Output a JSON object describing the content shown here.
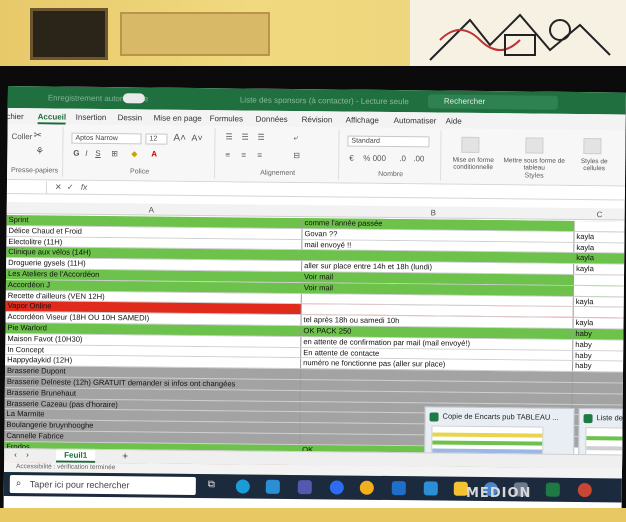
{
  "titlebar": {
    "autosave": "Enregistrement automatique",
    "doc_title": "Liste des sponsors (à contacter) - Lecture seule",
    "search_placeholder": "Rechercher"
  },
  "menu": [
    "Fichier",
    "Accueil",
    "Insertion",
    "Dessin",
    "Mise en page",
    "Formules",
    "Données",
    "Révision",
    "Affichage",
    "Automatiser",
    "Aide"
  ],
  "ribbon": {
    "font_name": "Aptos Narrow",
    "font_size": "12",
    "number_format": "Standard",
    "groups": {
      "clipboard": "Presse-papiers",
      "font": "Police",
      "alignment": "Alignement",
      "number": "Nombre",
      "styles": "Styles"
    },
    "styles_buttons": [
      "Mise en forme conditionnelle",
      "Mettre sous forme de tableau",
      "Styles de cellules"
    ],
    "paste": "Coller",
    "number_symbols": "% 000"
  },
  "formula_bar": {
    "fx": "fx"
  },
  "columns": [
    "A",
    "B",
    "C"
  ],
  "rows": [
    {
      "a": "Sprint",
      "b": "comme l'année passée",
      "c": "",
      "bg": "green"
    },
    {
      "a": "Délice Chaud et Froid",
      "b": "Govan ??",
      "c": "kayla",
      "bg": "white"
    },
    {
      "a": "Electolitre (11H)",
      "b": "mail envoyé !!",
      "c": "kayla",
      "bg": "white"
    },
    {
      "a": "Clinique aux vélos (14H)",
      "b": "",
      "c": "kayla",
      "bg": "green"
    },
    {
      "a": "Droguerie gysels (11H)",
      "b": "aller sur place entre 14h et 18h (lundi)",
      "c": "kayla",
      "bg": "white"
    },
    {
      "a": "Les Ateliers de l'Accordéon",
      "b": "Voir mail",
      "c": "",
      "bg": "green"
    },
    {
      "a": "Accordéon J",
      "b": "Voir mail",
      "c": "",
      "bg": "green"
    },
    {
      "a": "Recette d'ailleurs (VEN 12H)",
      "b": "",
      "c": "kayla",
      "bg": "white"
    },
    {
      "a": "Vapor Online",
      "b": "",
      "c": "",
      "bg": "red"
    },
    {
      "a": "Accordéon Viseur (18H OU 10H SAMEDI)",
      "b": "tel après 18h ou samedi 10h",
      "c": "kayla",
      "bg": "white"
    },
    {
      "a": "Pie Warlord",
      "b": "OK PACK 250",
      "c": "haby",
      "bg": "green"
    },
    {
      "a": "Maison Favot (10H30)",
      "b": "en attente de confirmation par mail (mail envoyé!)",
      "c": "haby",
      "bg": "white"
    },
    {
      "a": "In Concept",
      "b": "En attente de contacte",
      "c": "haby",
      "bg": "white"
    },
    {
      "a": "Happydaykid (12H)",
      "b": "numéro ne fonctionne pas (aller sur place)",
      "c": "haby",
      "bg": "white"
    },
    {
      "a": "Brasserie Dupont",
      "b": "",
      "c": "",
      "bg": "gray"
    },
    {
      "a": "Brasserie Delneste (12h) GRATUIT demander si infos ont changées",
      "b": "",
      "c": "",
      "bg": "gray"
    },
    {
      "a": "Brasserie Brunehaut",
      "b": "",
      "c": "",
      "bg": "gray"
    },
    {
      "a": "Brasserie Cazeau (pas d'horaire)",
      "b": "",
      "c": "",
      "bg": "gray"
    },
    {
      "a": "La Marmite",
      "b": "",
      "c": "",
      "bg": "gray"
    },
    {
      "a": "Boulangerie bruynhooghe",
      "b": "",
      "c": "",
      "bg": "gray"
    },
    {
      "a": "Cannelle Fabrice",
      "b": "",
      "c": "",
      "bg": "gray"
    },
    {
      "a": "Frodos",
      "b": "OK",
      "c": "",
      "bg": "green"
    },
    {
      "a": "Arc-en-ciel",
      "b": "",
      "c": "",
      "bg": "red"
    },
    {
      "a": "Hashtag",
      "b": "OK",
      "c": "",
      "bg": "green"
    }
  ],
  "popups": [
    {
      "title": "Copie de Encarts pub TABLEAU ..."
    },
    {
      "title": "Liste des"
    }
  ],
  "sheet_tab": "Feuil1",
  "add_sheet": "+",
  "status": "Accessibilité : vérification terminée",
  "taskbar": {
    "search": "Taper ici pour rechercher",
    "search_icon": "search-icon"
  },
  "brand": "MEDION",
  "colors": {
    "green": "#6cc24a",
    "red": "#e02b1c",
    "gray": "#a3a3a3",
    "excel": "#1f6f3f"
  }
}
